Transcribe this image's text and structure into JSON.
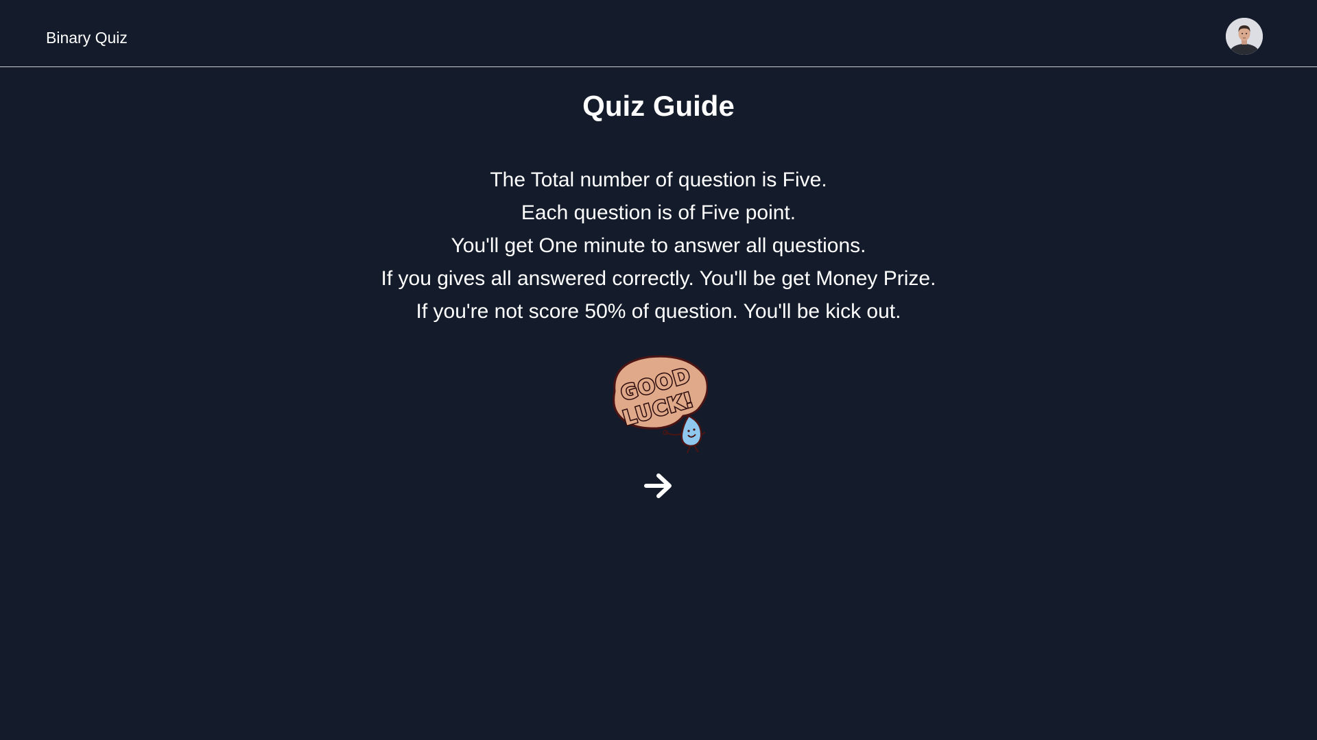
{
  "app": {
    "brand": "Binary Quiz"
  },
  "main": {
    "title": "Quiz Guide",
    "rules": [
      "The Total number of question is Five.",
      "Each question is of Five point.",
      "You'll get One minute to answer all questions.",
      "If you gives all answered correctly. You'll be get Money Prize.",
      "If you're not score 50% of question. You'll be kick out."
    ],
    "sticker_text": [
      "GOOD",
      "LUCK!"
    ],
    "next_icon": "arrow-right-icon"
  },
  "colors": {
    "background": "#141c2b",
    "text": "#ffffff",
    "divider": "#c9ced6",
    "sticker_bubble": "#e0a98a",
    "sticker_outline": "#4a1414",
    "sticker_drop": "#8fc8ee"
  }
}
